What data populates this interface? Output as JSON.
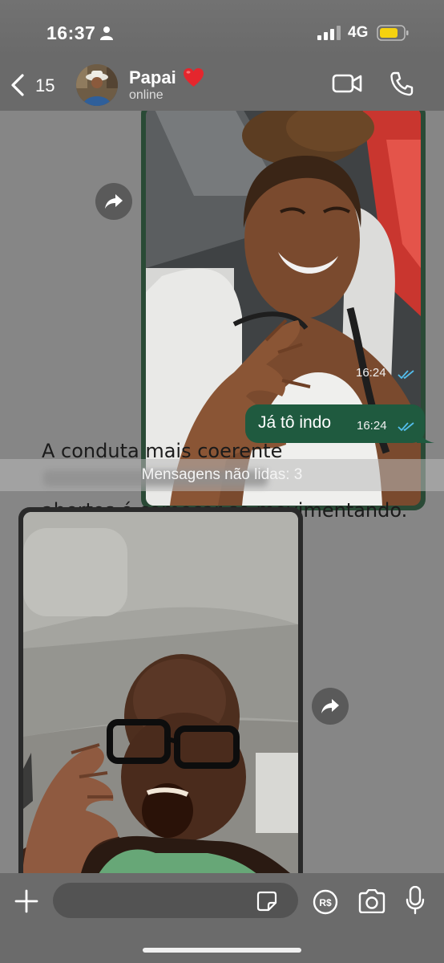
{
  "status_bar": {
    "time": "16:37",
    "network": "4G",
    "icons": [
      "person-icon",
      "signal-icon",
      "battery-icon"
    ]
  },
  "header": {
    "back_count": "15",
    "contact_name": "Papai",
    "contact_status": "online",
    "icons": [
      "back-icon",
      "heart-icon",
      "video-call-icon",
      "voice-call-icon"
    ]
  },
  "messages": [
    {
      "type": "image",
      "direction": "outgoing",
      "time": "16:24",
      "status": "read"
    },
    {
      "type": "text",
      "direction": "outgoing",
      "text": "Já tô indo",
      "time": "16:24",
      "status": "read"
    },
    {
      "type": "image",
      "direction": "incoming"
    }
  ],
  "overlay_text": {
    "line1": "A conduta mais coerente",
    "line3": "abertos é começar se movimentando."
  },
  "unread_banner": "Mensagens não lidas: 3",
  "input_bar": {
    "message_value": "",
    "icons": [
      "plus-icon",
      "sticker-icon",
      "payment-icon",
      "camera-icon",
      "mic-icon"
    ]
  },
  "colors": {
    "background": "#868686",
    "outgoing_bubble": "#1f5a3f",
    "read_ticks": "#53bdeb",
    "battery": "#f5d20f"
  }
}
